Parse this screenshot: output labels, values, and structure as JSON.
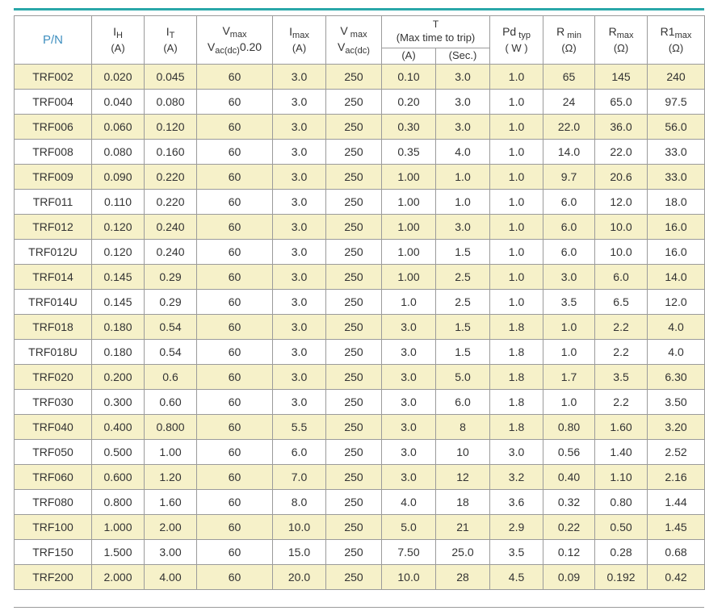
{
  "header": {
    "pn": "P/N",
    "ih": {
      "sym": "I",
      "sub": "H",
      "unit": "(A)"
    },
    "it": {
      "sym": "I",
      "sub": "T",
      "unit": "(A)"
    },
    "vmax_dc": {
      "sym": "V",
      "sub": "max",
      "line2": "V",
      "line2_sub": "ac(dc)",
      "line2_tail": "0.20"
    },
    "imax": {
      "sym": "I",
      "sub": "max",
      "unit": "(A)"
    },
    "vmax_ac": {
      "sym": "V",
      "sub": " max",
      "line2": "V",
      "line2_sub": "ac(dc)"
    },
    "t": {
      "title": "T",
      "note": "(Max time to trip)",
      "a": "(A)",
      "sec": "(Sec.)"
    },
    "pd": {
      "sym": "Pd",
      "sub": " typ",
      "unit": "( W )"
    },
    "rmin": {
      "sym": "R",
      "sub": " min",
      "unit": "(Ω)"
    },
    "rmax": {
      "sym": "R",
      "sub": "max",
      "unit": "(Ω)"
    },
    "r1max": {
      "sym": "R1",
      "sub": "max",
      "unit": "(Ω)"
    }
  },
  "rows": [
    [
      "TRF002",
      "0.020",
      "0.045",
      "60",
      "3.0",
      "250",
      "0.10",
      "3.0",
      "1.0",
      "65",
      "145",
      "240"
    ],
    [
      "TRF004",
      "0.040",
      "0.080",
      "60",
      "3.0",
      "250",
      "0.20",
      "3.0",
      "1.0",
      "24",
      "65.0",
      "97.5"
    ],
    [
      "TRF006",
      "0.060",
      "0.120",
      "60",
      "3.0",
      "250",
      "0.30",
      "3.0",
      "1.0",
      "22.0",
      "36.0",
      "56.0"
    ],
    [
      "TRF008",
      "0.080",
      "0.160",
      "60",
      "3.0",
      "250",
      "0.35",
      "4.0",
      "1.0",
      "14.0",
      "22.0",
      "33.0"
    ],
    [
      "TRF009",
      "0.090",
      "0.220",
      "60",
      "3.0",
      "250",
      "1.00",
      "1.0",
      "1.0",
      "9.7",
      "20.6",
      "33.0"
    ],
    [
      "TRF011",
      "0.110",
      "0.220",
      "60",
      "3.0",
      "250",
      "1.00",
      "1.0",
      "1.0",
      "6.0",
      "12.0",
      "18.0"
    ],
    [
      "TRF012",
      "0.120",
      "0.240",
      "60",
      "3.0",
      "250",
      "1.00",
      "3.0",
      "1.0",
      "6.0",
      "10.0",
      "16.0"
    ],
    [
      "TRF012U",
      "0.120",
      "0.240",
      "60",
      "3.0",
      "250",
      "1.00",
      "1.5",
      "1.0",
      "6.0",
      "10.0",
      "16.0"
    ],
    [
      "TRF014",
      "0.145",
      "0.29",
      "60",
      "3.0",
      "250",
      "1.00",
      "2.5",
      "1.0",
      "3.0",
      "6.0",
      "14.0"
    ],
    [
      "TRF014U",
      "0.145",
      "0.29",
      "60",
      "3.0",
      "250",
      "1.0",
      "2.5",
      "1.0",
      "3.5",
      "6.5",
      "12.0"
    ],
    [
      "TRF018",
      "0.180",
      "0.54",
      "60",
      "3.0",
      "250",
      "3.0",
      "1.5",
      "1.8",
      "1.0",
      "2.2",
      "4.0"
    ],
    [
      "TRF018U",
      "0.180",
      "0.54",
      "60",
      "3.0",
      "250",
      "3.0",
      "1.5",
      "1.8",
      "1.0",
      "2.2",
      "4.0"
    ],
    [
      "TRF020",
      "0.200",
      "0.6",
      "60",
      "3.0",
      "250",
      "3.0",
      "5.0",
      "1.8",
      "1.7",
      "3.5",
      "6.30"
    ],
    [
      "TRF030",
      "0.300",
      "0.60",
      "60",
      "3.0",
      "250",
      "3.0",
      "6.0",
      "1.8",
      "1.0",
      "2.2",
      "3.50"
    ],
    [
      "TRF040",
      "0.400",
      "0.800",
      "60",
      "5.5",
      "250",
      "3.0",
      "8",
      "1.8",
      "0.80",
      "1.60",
      "3.20"
    ],
    [
      "TRF050",
      "0.500",
      "1.00",
      "60",
      "6.0",
      "250",
      "3.0",
      "10",
      "3.0",
      "0.56",
      "1.40",
      "2.52"
    ],
    [
      "TRF060",
      "0.600",
      "1.20",
      "60",
      "7.0",
      "250",
      "3.0",
      "12",
      "3.2",
      "0.40",
      "1.10",
      "2.16"
    ],
    [
      "TRF080",
      "0.800",
      "1.60",
      "60",
      "8.0",
      "250",
      "4.0",
      "18",
      "3.6",
      "0.32",
      "0.80",
      "1.44"
    ],
    [
      "TRF100",
      "1.000",
      "2.00",
      "60",
      "10.0",
      "250",
      "5.0",
      "21",
      "2.9",
      "0.22",
      "0.50",
      "1.45"
    ],
    [
      "TRF150",
      "1.500",
      "3.00",
      "60",
      "15.0",
      "250",
      "7.50",
      "25.0",
      "3.5",
      "0.12",
      "0.28",
      "0.68"
    ],
    [
      "TRF200",
      "2.000",
      "4.00",
      "60",
      "20.0",
      "250",
      "10.0",
      "28",
      "4.5",
      "0.09",
      "0.192",
      "0.42"
    ]
  ],
  "colors": {
    "rule": "#2aa7a9",
    "stripe": "#f6f1c9",
    "pn_header": "#3f8fbf",
    "border": "#9b9b9b"
  }
}
